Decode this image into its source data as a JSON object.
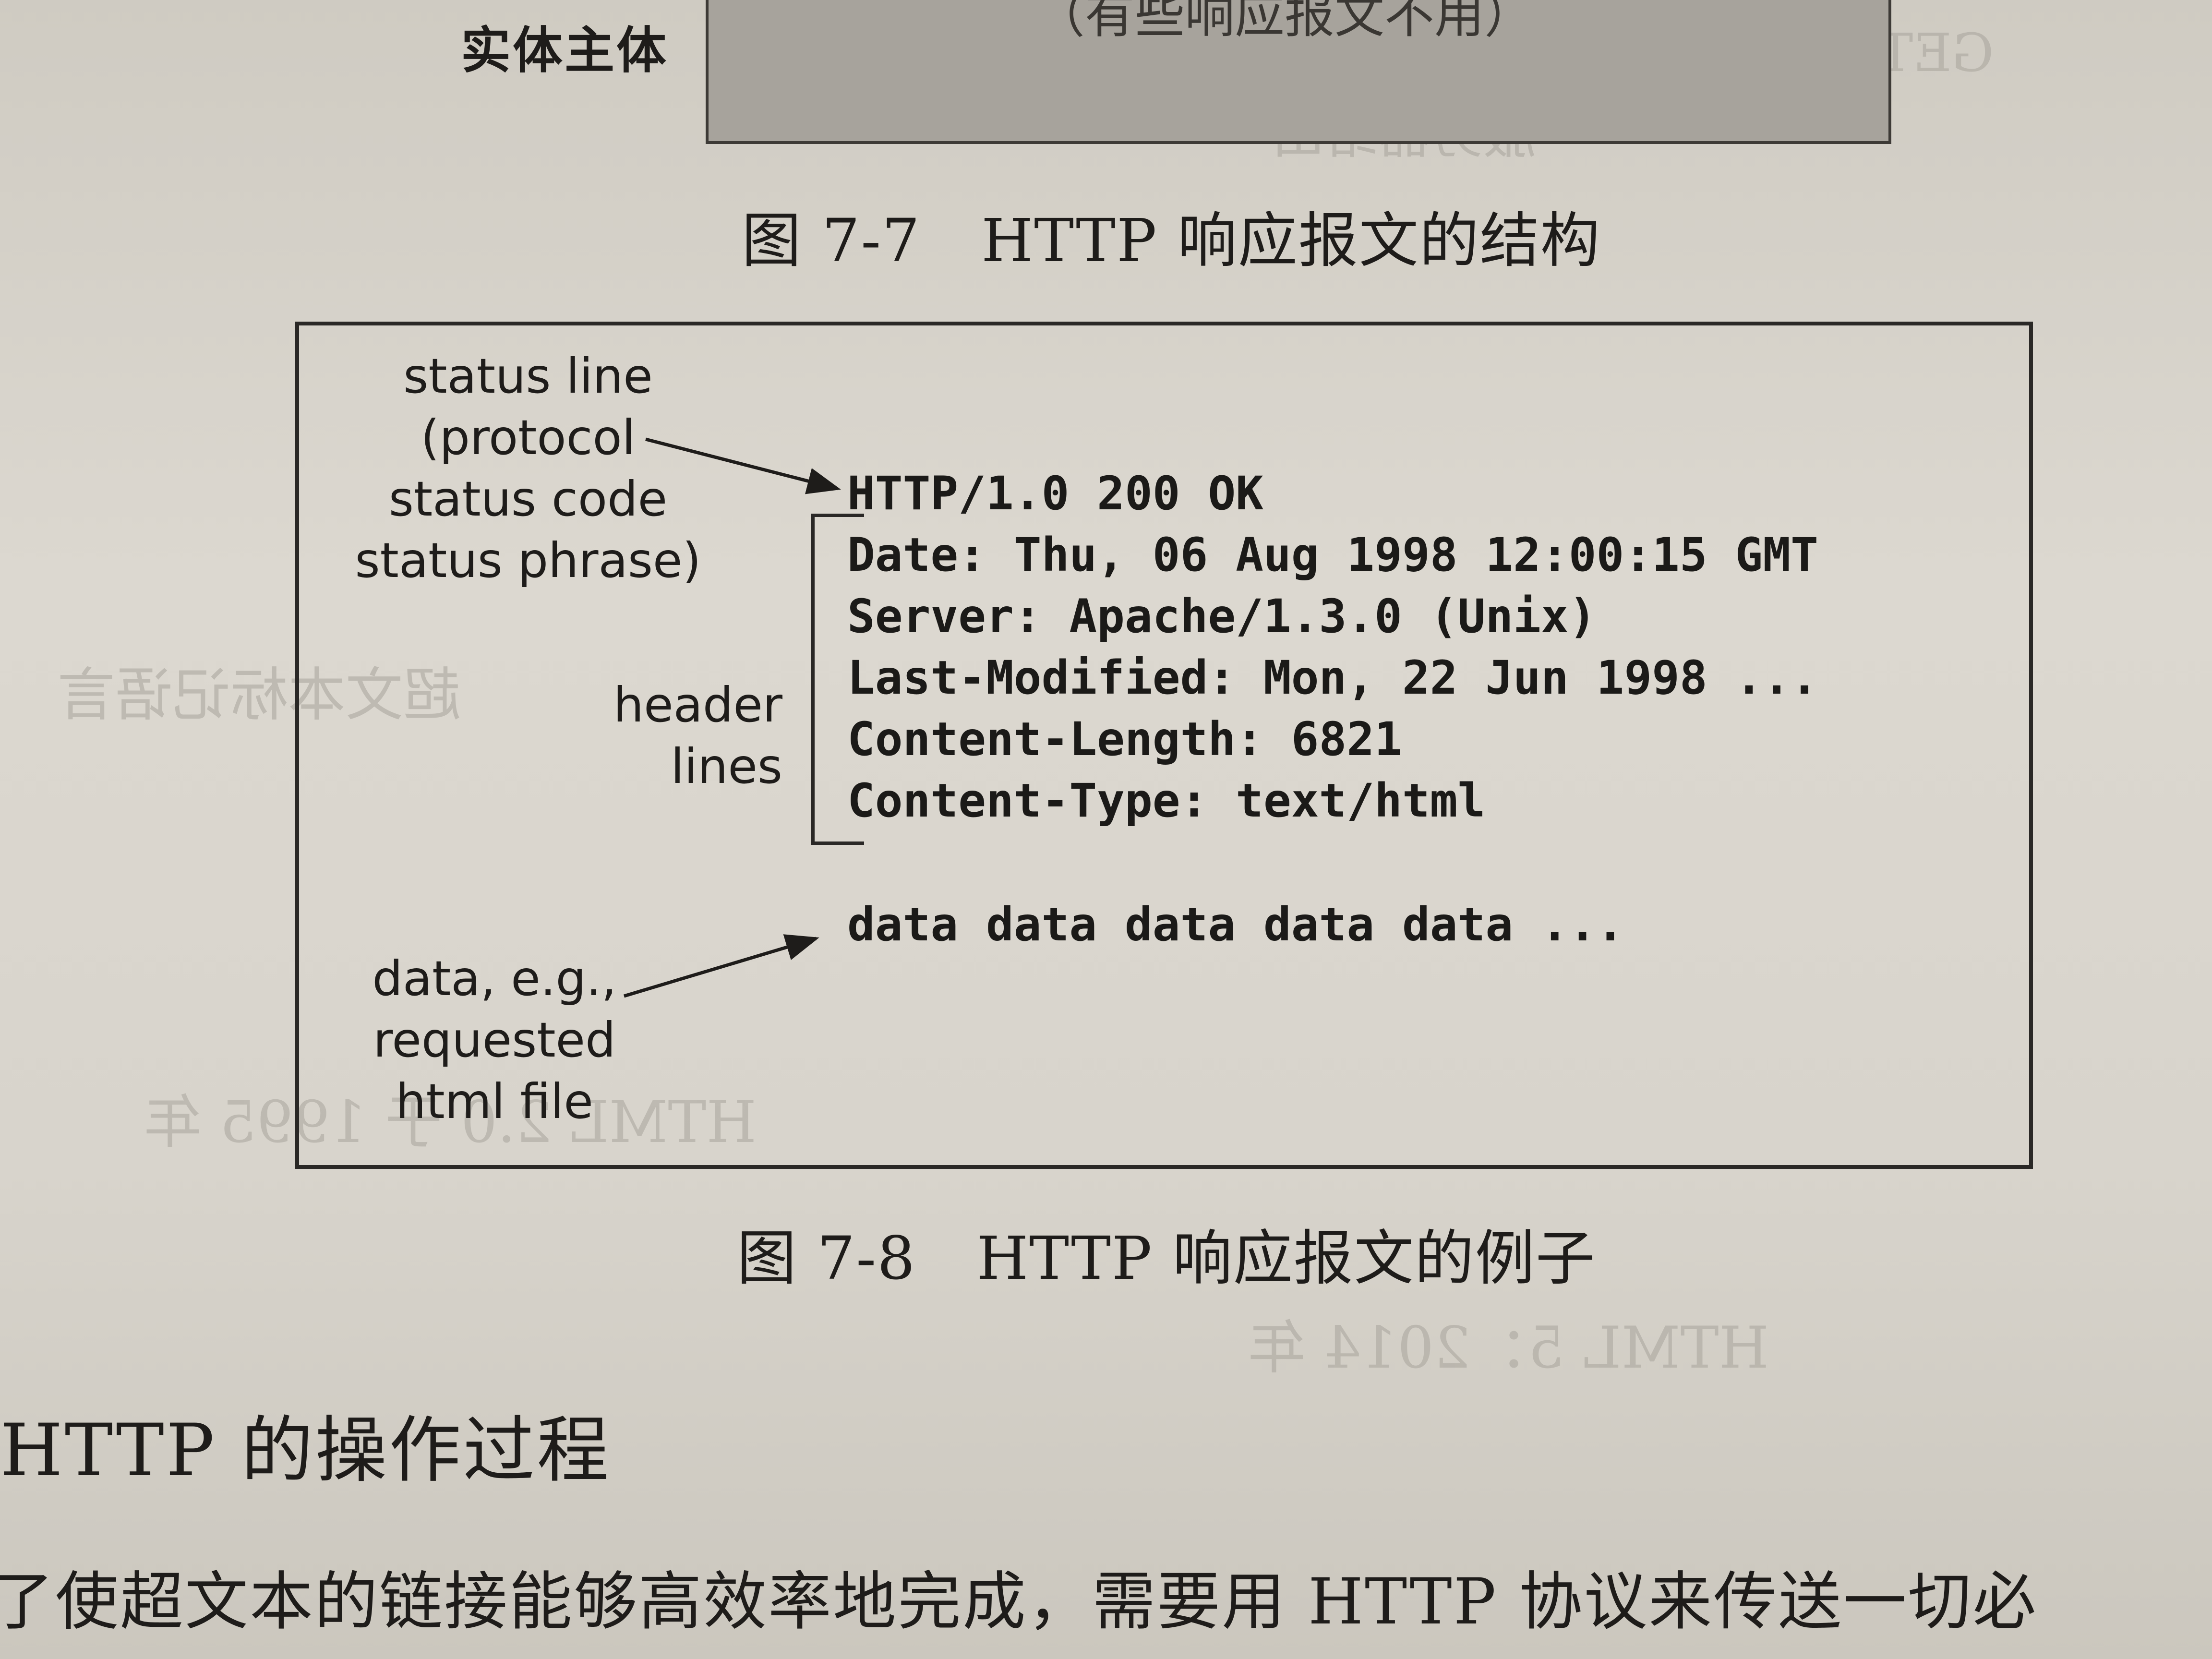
{
  "figure_7_7": {
    "entity_label": "实体主体",
    "box_text": "（有些响应报文不用）",
    "caption": "图 7-7　HTTP 响应报文的结构"
  },
  "figure_7_8": {
    "status_label_lines": [
      "status line",
      "(protocol",
      "status code",
      "status phrase)"
    ],
    "header_label_lines": [
      "header",
      "lines"
    ],
    "data_label_lines": [
      "data, e.g.,",
      "requested",
      "html file"
    ],
    "status_line": "HTTP/1.0 200 OK",
    "header_lines": [
      "Date: Thu, 06 Aug 1998 12:00:15 GMT",
      "Server: Apache/1.3.0 (Unix)",
      "Last-Modified: Mon, 22 Jun 1998 ...",
      "Content-Length: 6821",
      "Content-Type: text/html"
    ],
    "data_line": "data data data data data ...",
    "caption": "图 7-8　HTTP 响应报文的例子"
  },
  "section": {
    "heading": "HTTP 的操作过程",
    "body_line": "了使超文本的链接能够高效率地完成，需要用 HTTP 协议来传送一切必"
  }
}
